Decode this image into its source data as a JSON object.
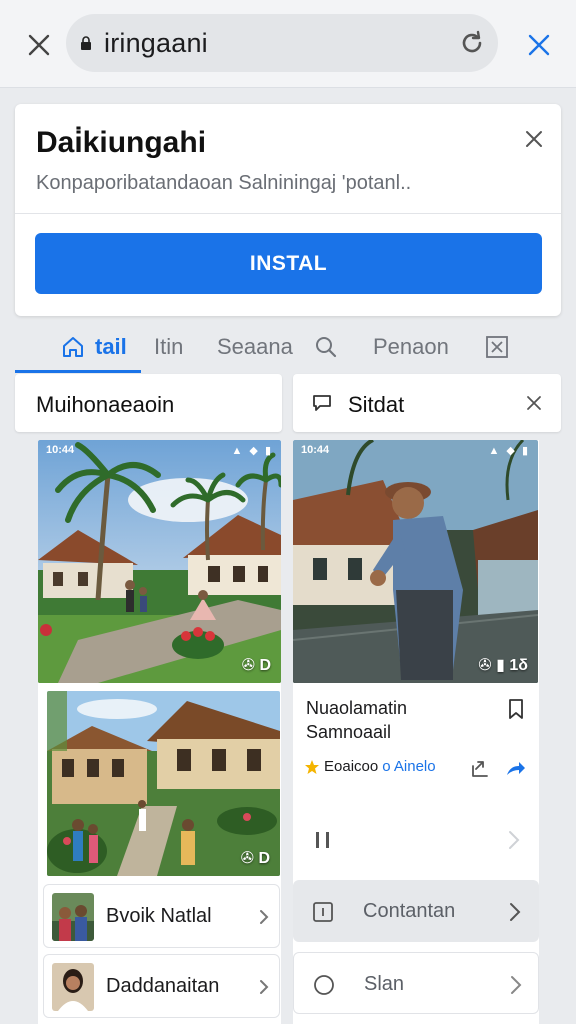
{
  "browser": {
    "url": "iringaani"
  },
  "install_banner": {
    "title": "Dai̇kiungahi",
    "subtitle": "Konpaporibatandaoan Salniningaj 'potanl..",
    "button_label": "INSTAL"
  },
  "tabs": [
    {
      "label": "tail",
      "icon": "home-icon",
      "active": true
    },
    {
      "label": "Itin",
      "active": false
    },
    {
      "label": "Seaana",
      "active": false
    },
    {
      "label": "",
      "icon": "search-icon",
      "active": false
    },
    {
      "label": "Penaon",
      "active": false
    },
    {
      "label": "",
      "icon": "x-box-icon",
      "active": false
    }
  ],
  "left_column": {
    "header": "Muihonaeaoin",
    "photo_top_badge": "✇ D",
    "photo_bottom_badge": "✇ D",
    "list_items": [
      {
        "label": "Bvoik Natlal"
      },
      {
        "label": "Daddanaitan"
      }
    ]
  },
  "right_column": {
    "header": "Sitdat",
    "photo_badge": "✇ ▮ 1δ",
    "article_title_line1": "Nuaolamatin",
    "article_title_line2": "Samnoaail",
    "meta_text": "Eoaicoo",
    "meta_accent": "o Ainelo",
    "rows": [
      {
        "label": "Contantan",
        "icon": "document-icon",
        "highlighted": true
      },
      {
        "label": "Slan",
        "icon": "circle-icon",
        "highlighted": false
      }
    ]
  },
  "colors": {
    "accent": "#1a73e8",
    "background": "#e9ebee",
    "card": "#ffffff",
    "highlight_row": "#e6e8eb"
  }
}
